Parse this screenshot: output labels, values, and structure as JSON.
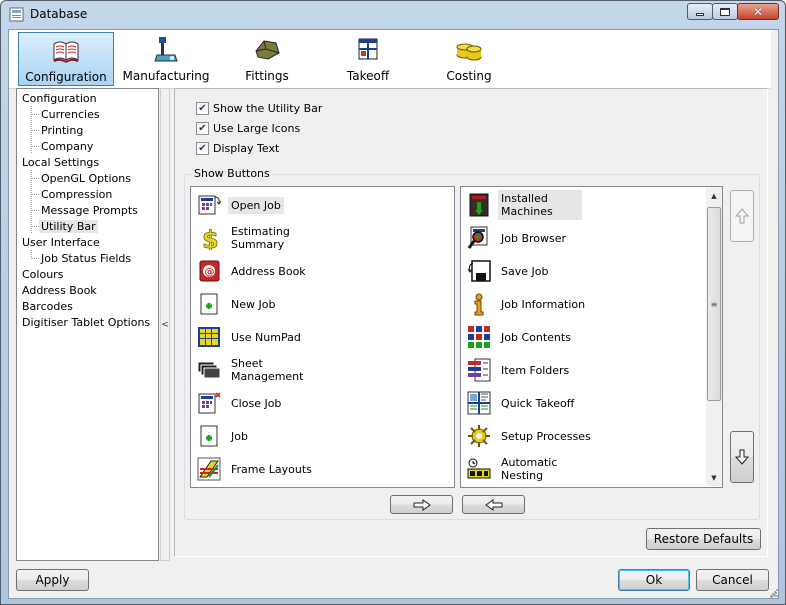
{
  "window": {
    "title": "Database"
  },
  "ribbon": {
    "tools": [
      {
        "label": "Configuration",
        "icon": "book-icon",
        "selected": true
      },
      {
        "label": "Manufacturing",
        "icon": "machine-icon"
      },
      {
        "label": "Fittings",
        "icon": "fitting-icon"
      },
      {
        "label": "Takeoff",
        "icon": "takeoff-icon"
      },
      {
        "label": "Costing",
        "icon": "coins-icon"
      }
    ]
  },
  "tree": {
    "items": [
      {
        "label": "Configuration",
        "level": 0
      },
      {
        "label": "Currencies",
        "level": 1
      },
      {
        "label": "Printing",
        "level": 1
      },
      {
        "label": "Company",
        "level": 1
      },
      {
        "label": "Local Settings",
        "level": 0
      },
      {
        "label": "OpenGL Options",
        "level": 1
      },
      {
        "label": "Compression",
        "level": 1
      },
      {
        "label": "Message Prompts",
        "level": 1
      },
      {
        "label": "Utility Bar",
        "level": 1,
        "selected": true
      },
      {
        "label": "User Interface",
        "level": 0
      },
      {
        "label": "Job Status Fields",
        "level": 1
      },
      {
        "label": "Colours",
        "level": 0
      },
      {
        "label": "Address Book",
        "level": 0
      },
      {
        "label": "Barcodes",
        "level": 0
      },
      {
        "label": "Digitiser Tablet Options",
        "level": 0
      }
    ]
  },
  "options": {
    "show_utility_bar": {
      "label": "Show the Utility Bar",
      "checked": true
    },
    "use_large_icons": {
      "label": "Use Large Icons",
      "checked": true
    },
    "display_text": {
      "label": "Display Text",
      "checked": true
    }
  },
  "show_buttons": {
    "label": "Show Buttons",
    "available": [
      {
        "label": "Open Job",
        "icon": "open-job-icon",
        "selected": true
      },
      {
        "label": "Estimating Summary",
        "icon": "dollar-icon"
      },
      {
        "label": "Address Book",
        "icon": "address-book-icon"
      },
      {
        "label": "New Job",
        "icon": "new-job-icon"
      },
      {
        "label": "Use NumPad",
        "icon": "numpad-icon"
      },
      {
        "label": "Sheet Management",
        "icon": "sheets-icon"
      },
      {
        "label": "Close Job",
        "icon": "close-job-icon"
      },
      {
        "label": "Job",
        "icon": "job-icon"
      },
      {
        "label": "Frame Layouts",
        "icon": "frame-layouts-icon"
      }
    ],
    "shown": [
      {
        "label": "Installed Machines",
        "icon": "installed-machines-icon",
        "selected": true
      },
      {
        "label": "Job Browser",
        "icon": "job-browser-icon"
      },
      {
        "label": "Save Job",
        "icon": "save-job-icon"
      },
      {
        "label": "Job Information",
        "icon": "info-icon"
      },
      {
        "label": "Job Contents",
        "icon": "job-contents-icon"
      },
      {
        "label": "Item Folders",
        "icon": "item-folders-icon"
      },
      {
        "label": "Quick Takeoff",
        "icon": "quick-takeoff-icon"
      },
      {
        "label": "Setup Processes",
        "icon": "setup-processes-icon"
      },
      {
        "label": "Automatic Nesting",
        "icon": "nesting-icon"
      }
    ]
  },
  "buttons": {
    "restore_defaults": "Restore Defaults",
    "apply": "Apply",
    "ok": "Ok",
    "cancel": "Cancel"
  },
  "colors": {
    "accent": "#3c7fb1",
    "selection": "#e6e6e6",
    "titlebar": "#c3d6ea"
  }
}
